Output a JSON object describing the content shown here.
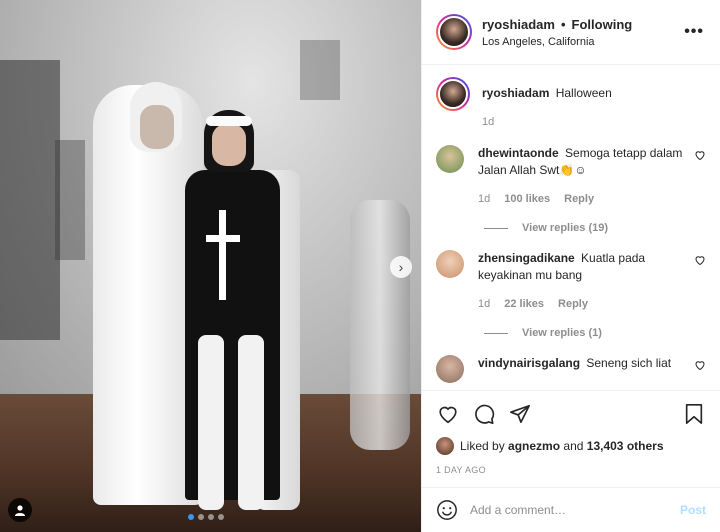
{
  "post": {
    "carousel": {
      "total": 4,
      "active_index": 0
    }
  },
  "header": {
    "username": "ryoshiadam",
    "separator": "•",
    "follow_status": "Following",
    "location": "Los Angeles, California",
    "more_icon": "more-horizontal-icon"
  },
  "caption": {
    "username": "ryoshiadam",
    "text": "Halloween",
    "time": "1d"
  },
  "comments": [
    {
      "username": "dhewintaonde",
      "text": "Semoga tetapp dalam Jalan Allah Swt👏☺",
      "time": "1d",
      "likes": "100 likes",
      "reply_label": "Reply",
      "view_replies": "View replies (19)",
      "avatar_color": "#6b8e4e"
    },
    {
      "username": "zhensingadikane",
      "text": "Kuatla pada keyakinan mu bang",
      "time": "1d",
      "likes": "22 likes",
      "reply_label": "Reply",
      "view_replies": "View replies (1)",
      "avatar_color": "#c98f6a"
    },
    {
      "username": "vindynairisgalang",
      "text": "Seneng sich liat",
      "avatar_color": "#8a6a5a"
    }
  ],
  "actions": {
    "like_icon": "heart-icon",
    "comment_icon": "comment-icon",
    "share_icon": "share-icon",
    "save_icon": "bookmark-icon"
  },
  "likes": {
    "prefix": "Liked by",
    "user": "agnezmo",
    "conj": "and",
    "others": "13,403 others"
  },
  "post_time": "1 DAY AGO",
  "add_comment": {
    "placeholder": "Add a comment…",
    "post_label": "Post",
    "emoji_icon": "emoji-icon"
  },
  "colors": {
    "accent": "#3897f0",
    "post_disabled": "#b2dffc",
    "muted": "#8e8e8e",
    "text": "#262626"
  }
}
